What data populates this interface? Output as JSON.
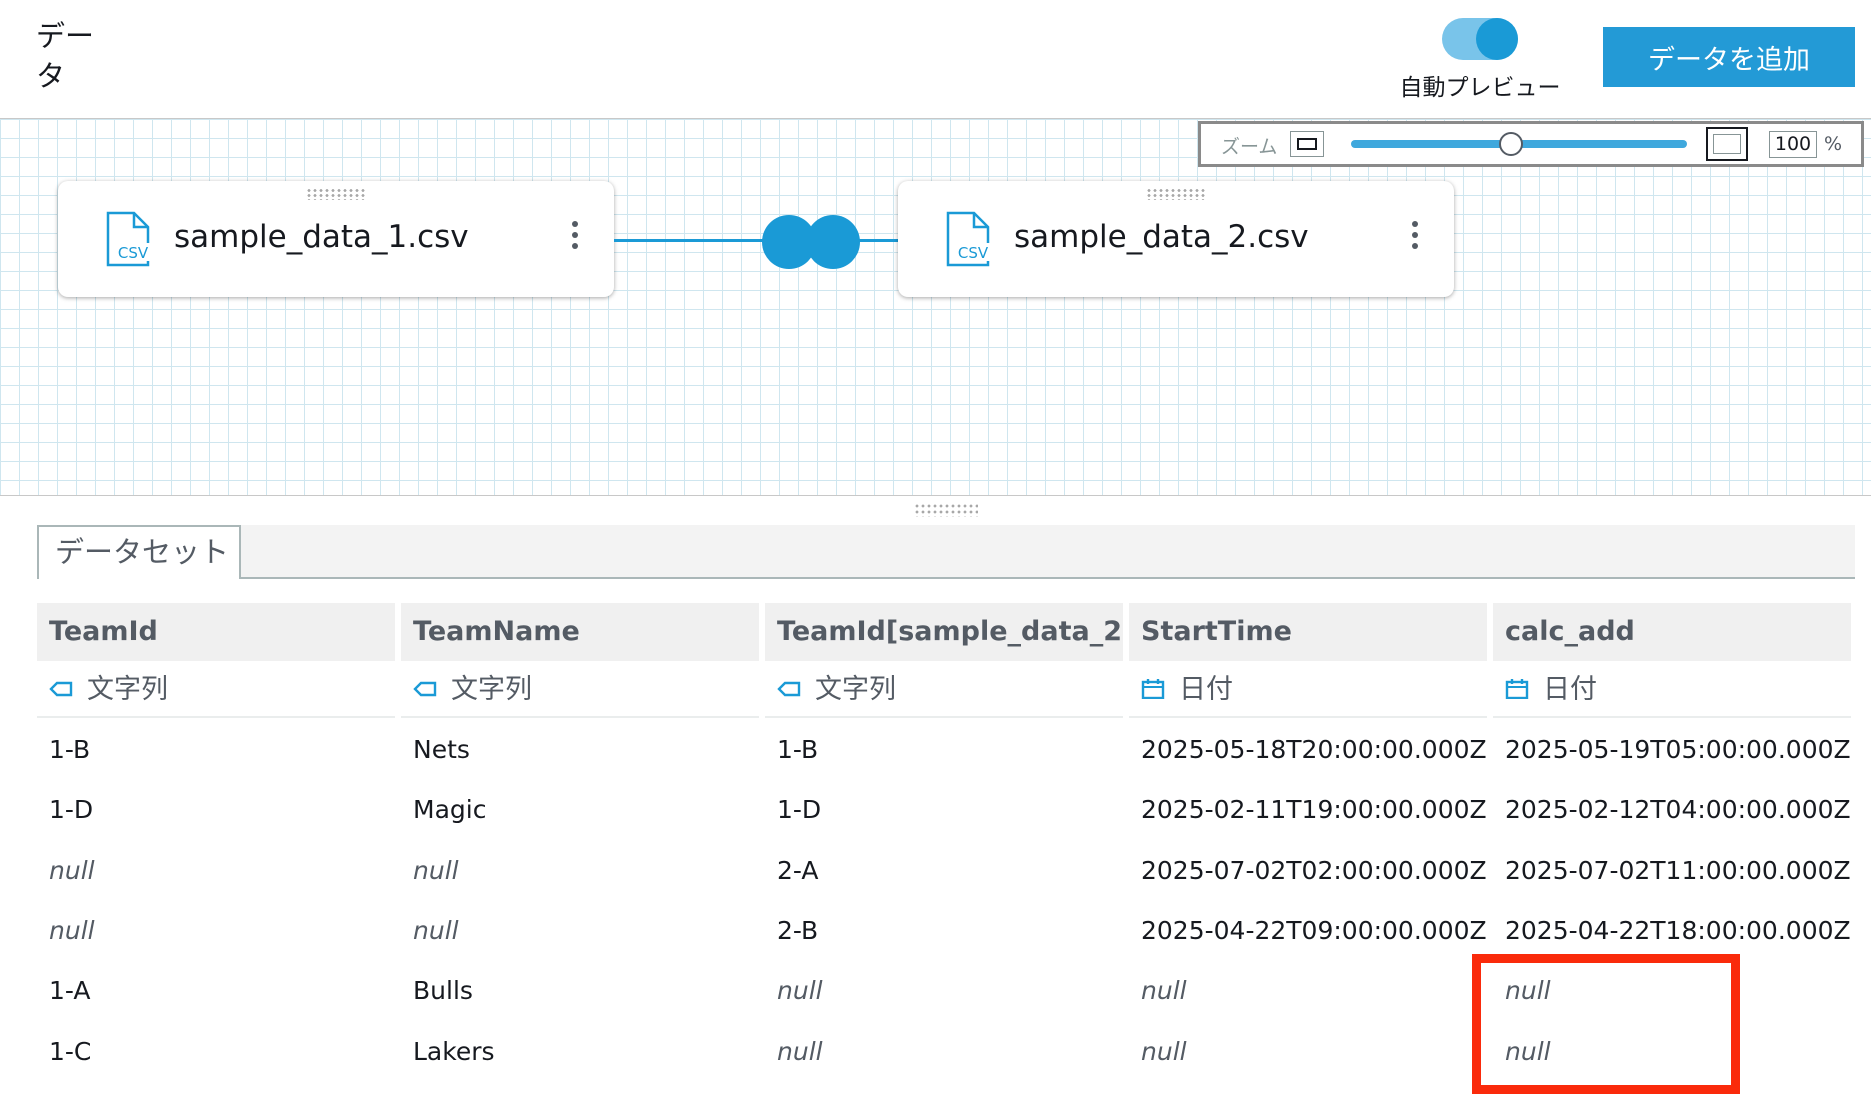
{
  "header": {
    "title": "データ",
    "auto_preview_label": "自動プレビュー",
    "auto_preview_on": true,
    "add_data_label": "データを追加"
  },
  "zoom": {
    "label": "ズーム",
    "value": "100",
    "unit": "%",
    "level_fraction": 0.5
  },
  "nodes": [
    {
      "file_type": "CSV",
      "name": "sample_data_1.csv"
    },
    {
      "file_type": "CSV",
      "name": "sample_data_2.csv"
    }
  ],
  "dataset_tab": {
    "label": "データセット"
  },
  "table": {
    "columns": [
      {
        "header": "TeamId",
        "type_label": "文字列",
        "type_icon": "string-tag-icon"
      },
      {
        "header": "TeamName",
        "type_label": "文字列",
        "type_icon": "string-tag-icon"
      },
      {
        "header": "TeamId[sample_data_2...",
        "type_label": "文字列",
        "type_icon": "string-tag-icon"
      },
      {
        "header": "StartTime",
        "type_label": "日付",
        "type_icon": "calendar-icon"
      },
      {
        "header": "calc_add",
        "type_label": "日付",
        "type_icon": "calendar-icon"
      }
    ],
    "rows": [
      [
        "1-B",
        "Nets",
        "1-B",
        "2025-05-18T20:00:00.000Z",
        "2025-05-19T05:00:00.000Z"
      ],
      [
        "1-D",
        "Magic",
        "1-D",
        "2025-02-11T19:00:00.000Z",
        "2025-02-12T04:00:00.000Z"
      ],
      [
        "null",
        "null",
        "2-A",
        "2025-07-02T02:00:00.000Z",
        "2025-07-02T11:00:00.000Z"
      ],
      [
        "null",
        "null",
        "2-B",
        "2025-04-22T09:00:00.000Z",
        "2025-04-22T18:00:00.000Z"
      ],
      [
        "1-A",
        "Bulls",
        "null",
        "null",
        "null"
      ],
      [
        "1-C",
        "Lakers",
        "null",
        "null",
        "null"
      ]
    ]
  },
  "colors": {
    "accent": "#1a9ad6",
    "button": "#239ad6",
    "highlight": "#fa2a0b",
    "header_bg": "#f0f0f0"
  }
}
